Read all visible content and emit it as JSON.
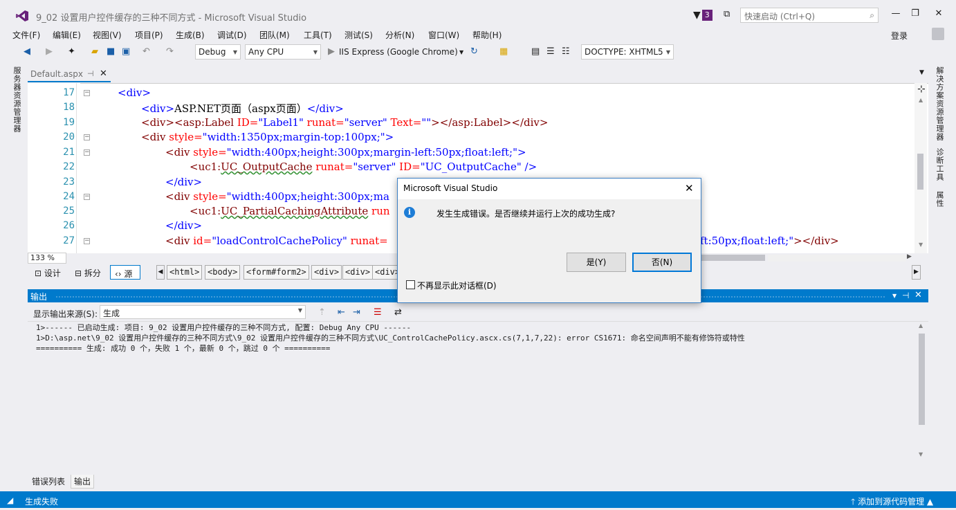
{
  "window": {
    "title": "9_02 设置用户控件缓存的三种不同方式 - Microsoft Visual Studio",
    "notification_count": "3",
    "quick_launch_placeholder": "快速启动 (Ctrl+Q)",
    "minimize": "—",
    "restore": "❐",
    "close": "✕"
  },
  "menu": [
    "文件(F)",
    "编辑(E)",
    "视图(V)",
    "项目(P)",
    "生成(B)",
    "调试(D)",
    "团队(M)",
    "工具(T)",
    "测试(S)",
    "分析(N)",
    "窗口(W)",
    "帮助(H)"
  ],
  "account": {
    "login": "登录"
  },
  "toolbar": {
    "configuration": "Debug",
    "platform": "Any CPU",
    "run_target": "IIS Express (Google Chrome)",
    "doctype": "DOCTYPE: XHTML5"
  },
  "left_tabs": {
    "server_explorer": "服务器资源管理器"
  },
  "right_tabs": {
    "solution_explorer": "解决方案资源管理器",
    "diagnostics": "诊断工具",
    "properties": "属性"
  },
  "document_tab": {
    "name": "Default.aspx",
    "pin": "⊣",
    "close": "✕"
  },
  "editor": {
    "line_numbers": [
      "17",
      "18",
      "19",
      "20",
      "21",
      "22",
      "23",
      "24",
      "25",
      "26",
      "27"
    ],
    "lines": {
      "l17": "<div>",
      "l18_open": "<div>",
      "l18_text": "ASP.NET页面（aspx页面）",
      "l18_close": "</div>",
      "l19_a": "<div><asp:Label ",
      "l19_b": "ID=",
      "l19_c": "\"Label1\"",
      "l19_d": " runat=",
      "l19_e": "\"server\"",
      "l19_f": " Text=",
      "l19_g": "\"\"",
      "l19_h": "></asp:Label></div>",
      "l20_a": "<div ",
      "l20_b": "style=",
      "l20_c": "\"width:1350px;margin-top:100px;\"",
      "l20_d": ">",
      "l21_a": "<div ",
      "l21_b": "style=",
      "l21_c": "\"width:400px;height:300px;margin-left:50px;float:left;\"",
      "l21_d": ">",
      "l22_a": "<uc1:",
      "l22_b": "UC_OutputCache",
      "l22_c": " runat=",
      "l22_d": "\"server\"",
      "l22_e": " ID=",
      "l22_f": "\"UC_OutputCache\"",
      "l22_g": " />",
      "l23": "</div>",
      "l24_a": "<div ",
      "l24_b": "style=",
      "l24_c": "\"width:400px;height:300px;ma",
      "l25_a": "<uc1:",
      "l25_b": "UC_PartialCachingAttribute",
      "l25_c": " run",
      "l26": "</div>",
      "l27_a": "<div ",
      "l27_b": "id=",
      "l27_c": "\"loadControlCachePolicy\"",
      "l27_d": " runat=",
      "l27_e": "ft:50px;float:left;\"",
      "l27_f": "></div>"
    },
    "zoom": "133 %"
  },
  "view_buttons": {
    "design": "设计",
    "split": "拆分",
    "source": "源"
  },
  "breadcrumbs": [
    "<html>",
    "<body>",
    "<form#form2>",
    "<div>",
    "<div>",
    "<div>"
  ],
  "output": {
    "title": "输出",
    "source_label": "显示输出来源(S):",
    "source_value": "生成",
    "lines": [
      "1>------ 已启动生成: 项目: 9_02 设置用户控件缓存的三种不同方式, 配置: Debug Any CPU ------",
      "1>D:\\asp.net\\9_02 设置用户控件缓存的三种不同方式\\9_02 设置用户控件缓存的三种不同方式\\UC_ControlCachePolicy.ascx.cs(7,1,7,22): error CS1671: 命名空间声明不能有修饰符或特性",
      "========== 生成: 成功 0 个，失败 1 个，最新 0 个，跳过 0 个 =========="
    ]
  },
  "bottom_tabs": {
    "error_list": "错误列表",
    "output": "输出"
  },
  "status": {
    "left": "生成失败",
    "right": "添加到源代码管理"
  },
  "dialog": {
    "title": "Microsoft Visual Studio",
    "message": "发生生成错误。是否继续并运行上次的成功生成?",
    "yes": "是(Y)",
    "no": "否(N)",
    "checkbox_label": "不再显示此对话框(D)"
  }
}
